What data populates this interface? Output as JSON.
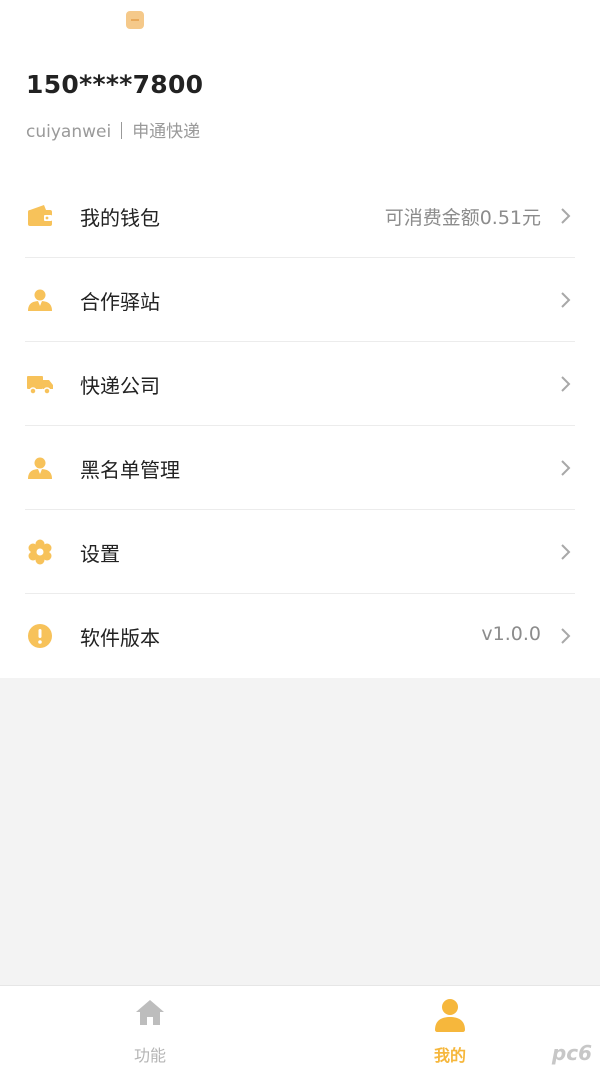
{
  "profile": {
    "phone": "150****7800",
    "username": "cuiyanwei",
    "company": "申通快递"
  },
  "menu": {
    "items": [
      {
        "label": "我的钱包",
        "value": "可消费金额0.51元",
        "icon": "wallet-icon"
      },
      {
        "label": "合作驿站",
        "value": "",
        "icon": "person-icon"
      },
      {
        "label": "快递公司",
        "value": "",
        "icon": "truck-icon"
      },
      {
        "label": "黑名单管理",
        "value": "",
        "icon": "person-icon"
      },
      {
        "label": "设置",
        "value": "",
        "icon": "gear-icon"
      },
      {
        "label": "软件版本",
        "value": "v1.0.0",
        "icon": "info-icon"
      }
    ]
  },
  "tabbar": {
    "func_label": "功能",
    "mine_label": "我的"
  },
  "watermark": "pc6",
  "colors": {
    "accent": "#f6b73c",
    "icon": "#f7c25a",
    "tab_inactive": "#b5b5b5"
  }
}
